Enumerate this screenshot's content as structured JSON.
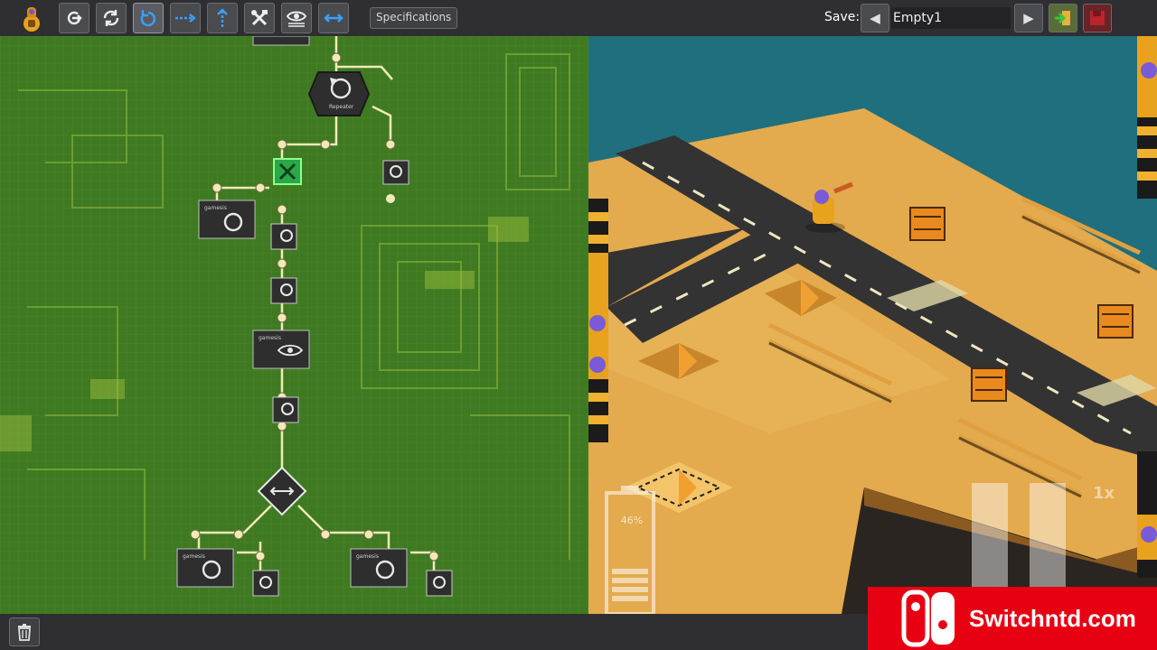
{
  "toolbar": {
    "tools": [
      {
        "name": "character-icon",
        "glyph": ""
      },
      {
        "name": "move-forward-icon",
        "glyph": "⟳"
      },
      {
        "name": "rotate-icon",
        "glyph": "↻"
      },
      {
        "name": "turn-left-icon",
        "glyph": "↺"
      },
      {
        "name": "dashed-arrow-icon",
        "glyph": "⇢"
      },
      {
        "name": "up-arrow-icon",
        "glyph": "↑"
      },
      {
        "name": "tools-icon",
        "glyph": "✕"
      },
      {
        "name": "eye-scan-icon",
        "glyph": "◉"
      },
      {
        "name": "swap-arrows-icon",
        "glyph": "↔"
      }
    ],
    "specifications_label": "Specifications"
  },
  "save": {
    "label": "Save:",
    "slot_name": "Empty1",
    "prev_glyph": "◀",
    "next_glyph": "▶"
  },
  "game": {
    "battery_percent": "46%",
    "speed": "1x"
  },
  "watermark": {
    "text": "Switchntd.com"
  },
  "colors": {
    "board_green": "#3f7a22",
    "chip_dark": "#2e2e2e",
    "wire": "#f2e9b8",
    "sand": "#e3aa4e",
    "road": "#333333",
    "water": "#1f6f7e",
    "brand_red": "#e60012"
  }
}
